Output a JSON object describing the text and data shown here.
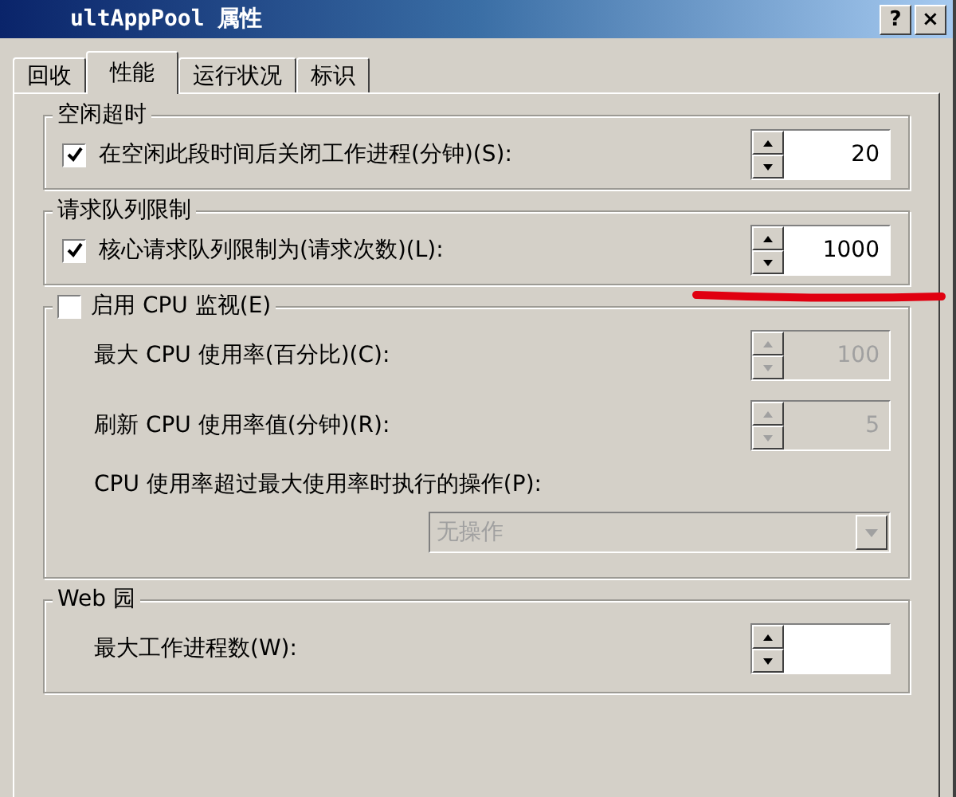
{
  "window": {
    "title": "ultAppPool 属性",
    "buttons": [
      "?",
      "×"
    ]
  },
  "tabs": [
    {
      "label": "回收",
      "selected": false
    },
    {
      "label": "性能",
      "selected": true
    },
    {
      "label": "运行状况",
      "selected": false
    },
    {
      "label": "标识",
      "selected": false
    }
  ],
  "groups": [
    {
      "title": {
        "kind": "text",
        "label": "空闲超时"
      },
      "rows": [
        {
          "kind": "checkbox-spinner",
          "label": "在空闲此段时间后关闭工作进程(分钟)(S):",
          "checked": true,
          "value": "20",
          "disabled": false
        }
      ]
    },
    {
      "title": {
        "kind": "text",
        "label": "请求队列限制"
      },
      "rows": [
        {
          "kind": "checkbox-spinner",
          "label": "核心请求队列限制为(请求次数)(L):",
          "checked": true,
          "value": "1000",
          "disabled": false
        }
      ]
    },
    {
      "title": {
        "kind": "checkbox",
        "label": "启用 CPU 监视(E)",
        "checked": false
      },
      "rows": [
        {
          "kind": "spinner",
          "label": "最大 CPU 使用率(百分比)(C):",
          "value": "100",
          "disabled": true
        },
        {
          "kind": "spinner",
          "label": "刷新 CPU 使用率值(分钟)(R):",
          "value": "5",
          "disabled": true
        },
        {
          "kind": "label",
          "label": "CPU 使用率超过最大使用率时执行的操作(P):"
        },
        {
          "kind": "dropdown",
          "value": "无操作",
          "disabled": true
        }
      ]
    },
    {
      "title": {
        "kind": "text",
        "label": "Web 园"
      },
      "rows": [
        {
          "kind": "spinner",
          "label": "最大工作进程数(W):",
          "disabled": false
        }
      ]
    }
  ]
}
